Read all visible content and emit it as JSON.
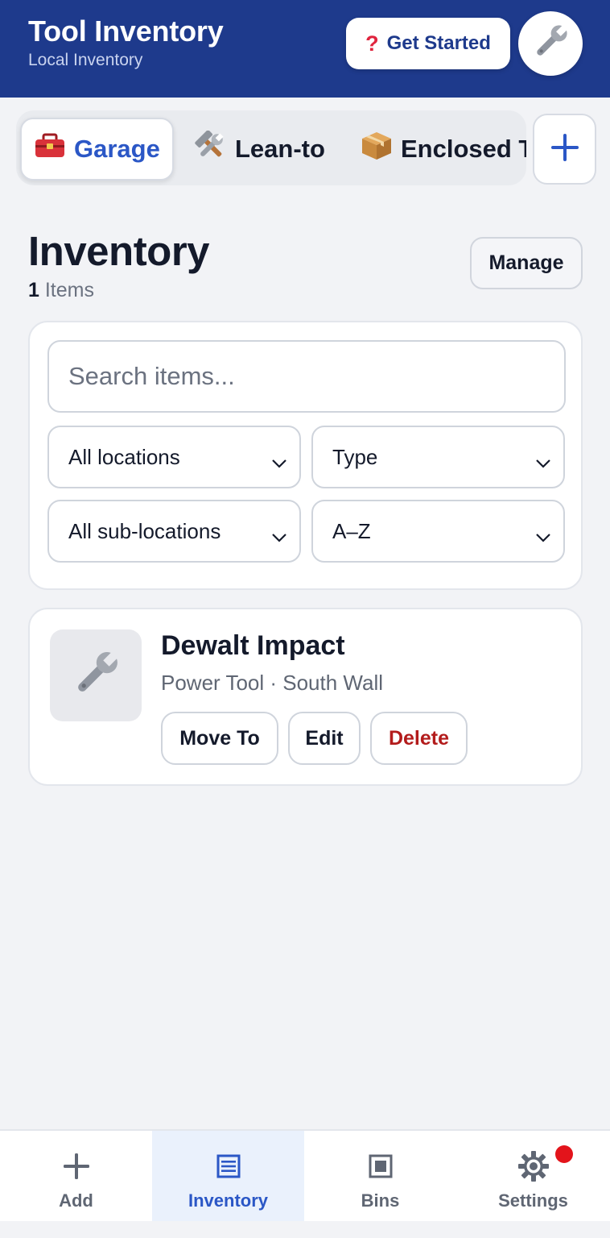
{
  "header": {
    "title": "Tool Inventory",
    "subtitle": "Local Inventory",
    "get_started_label": "Get Started",
    "get_started_icon": "question-mark-icon",
    "avatar_icon": "wrench-icon"
  },
  "location_tabs": [
    {
      "label": "Garage",
      "icon": "toolbox-icon",
      "active": true
    },
    {
      "label": "Lean-to",
      "icon": "hammer-and-wrench-icon",
      "active": false
    },
    {
      "label": "Enclosed T",
      "icon": "package-icon",
      "active": false
    }
  ],
  "add_location_icon": "plus-icon",
  "inventory": {
    "title": "Inventory",
    "count": "1",
    "count_label": "Items",
    "manage_label": "Manage"
  },
  "filters": {
    "search_placeholder": "Search items...",
    "location": "All locations",
    "type": "Type",
    "sub_location": "All sub-locations",
    "sort": "A–Z"
  },
  "items": [
    {
      "name": "Dewalt Impact",
      "meta": "Power Tool · South Wall",
      "icon": "wrench-icon",
      "actions": {
        "move": "Move To",
        "edit": "Edit",
        "delete": "Delete"
      }
    }
  ],
  "bottom_nav": [
    {
      "label": "Add",
      "icon": "plus-icon",
      "active": false
    },
    {
      "label": "Inventory",
      "icon": "list-icon",
      "active": true
    },
    {
      "label": "Bins",
      "icon": "bin-icon",
      "active": false
    },
    {
      "label": "Settings",
      "icon": "gear-icon",
      "active": false,
      "notification": true
    }
  ],
  "colors": {
    "header_bg": "#1e3a8c",
    "accent": "#2b57c6",
    "danger": "#b31c1c",
    "notification": "#e3141b",
    "page_bg": "#f2f3f6"
  }
}
